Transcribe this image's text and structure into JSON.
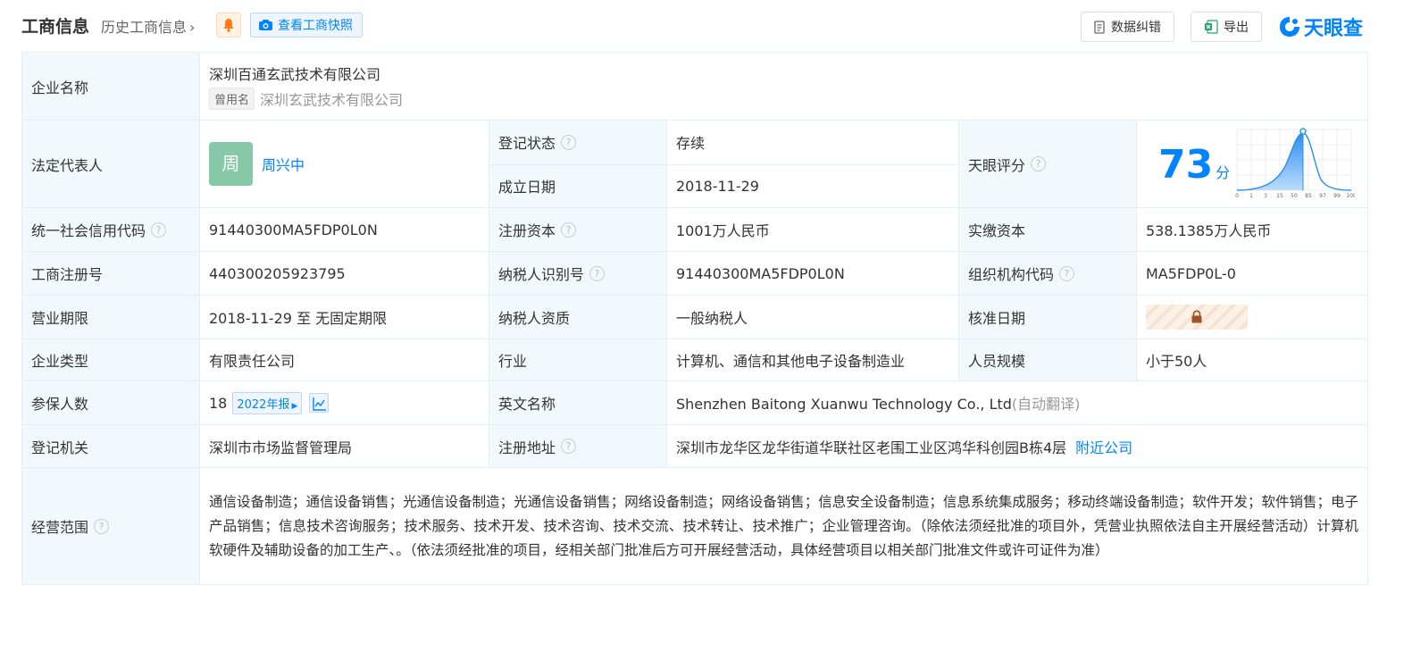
{
  "header": {
    "title": "工商信息",
    "history_link": "历史工商信息",
    "snapshot_label": "查看工商快照",
    "correct_label": "数据纠错",
    "export_label": "导出",
    "logo_text": "天眼查"
  },
  "company": {
    "name_label": "企业名称",
    "name": "深圳百通玄武技术有限公司",
    "used_name_tag": "曾用名",
    "used_name": "深圳玄武技术有限公司"
  },
  "legal": {
    "label": "法定代表人",
    "avatar_char": "周",
    "name": "周兴中"
  },
  "reg_status": {
    "label": "登记状态",
    "value": "存续"
  },
  "established": {
    "label": "成立日期",
    "value": "2018-11-29"
  },
  "tianyan_score": {
    "label": "天眼评分",
    "value": "73",
    "unit": "分",
    "axis_ticks": [
      "0",
      "1",
      "3",
      "15",
      "50",
      "85",
      "97",
      "99",
      "100"
    ]
  },
  "credit_code": {
    "label": "统一社会信用代码",
    "value": "91440300MA5FDP0L0N"
  },
  "reg_capital": {
    "label": "注册资本",
    "value": "1001万人民币"
  },
  "paid_capital": {
    "label": "实缴资本",
    "value": "538.1385万人民币"
  },
  "reg_number": {
    "label": "工商注册号",
    "value": "440300205923795"
  },
  "taxpayer_id": {
    "label": "纳税人识别号",
    "value": "91440300MA5FDP0L0N"
  },
  "org_code": {
    "label": "组织机构代码",
    "value": "MA5FDP0L-0"
  },
  "term": {
    "label": "营业期限",
    "value": "2018-11-29 至 无固定期限"
  },
  "taxpayer_type": {
    "label": "纳税人资质",
    "value": "一般纳税人"
  },
  "approval_date": {
    "label": "核准日期"
  },
  "company_type": {
    "label": "企业类型",
    "value": "有限责任公司"
  },
  "industry": {
    "label": "行业",
    "value": "计算机、通信和其他电子设备制造业"
  },
  "staff_size": {
    "label": "人员规模",
    "value": "小于50人"
  },
  "insured": {
    "label": "参保人数",
    "value": "18",
    "report_label": "2022年报"
  },
  "english_name": {
    "label": "英文名称",
    "value": "Shenzhen Baitong Xuanwu Technology Co., Ltd",
    "note": "(自动翻译)"
  },
  "authority": {
    "label": "登记机关",
    "value": "深圳市市场监督管理局"
  },
  "address": {
    "label": "注册地址",
    "value": "深圳市龙华区龙华街道华联社区老围工业区鸿华科创园B栋4层",
    "nearby_label": "附近公司"
  },
  "scope": {
    "label": "经营范围",
    "value": "通信设备制造；通信设备销售；光通信设备制造；光通信设备销售；网络设备制造；网络设备销售；信息安全设备制造；信息系统集成服务；移动终端设备制造；软件开发；软件销售；电子产品销售；信息技术咨询服务；技术服务、技术开发、技术咨询、技术交流、技术转让、技术推广；企业管理咨询。（除依法须经批准的项目外，凭营业执照依法自主开展经营活动）计算机软硬件及辅助设备的加工生产、。（依法须经批准的项目，经相关部门批准后方可开展经营活动，具体经营项目以相关部门批准文件或许可证件为准）"
  },
  "colors": {
    "accent": "#0084ff",
    "label_bg": "#f2f9fc",
    "status_green": "#00a000",
    "avatar": "#86c9a9"
  },
  "icons": [
    "bell-icon",
    "camera-icon",
    "document-icon",
    "excel-icon",
    "help-icon",
    "lock-icon",
    "trend-icon",
    "chevron-right-icon"
  ]
}
